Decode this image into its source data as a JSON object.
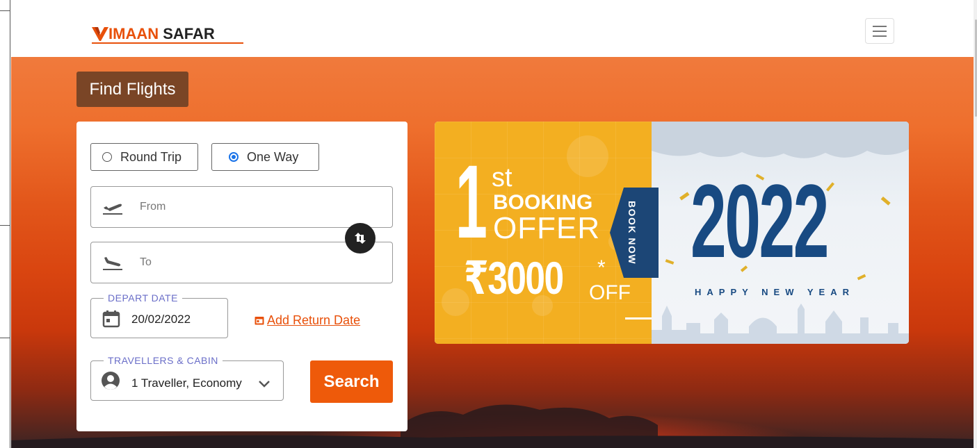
{
  "brand": {
    "name_part1": "IMAAN",
    "name_part2": " SAFAR",
    "accent_color": "#e8500a"
  },
  "header": {
    "menu_icon": "hamburger-icon"
  },
  "search_panel": {
    "title": "Find Flights",
    "trip_types": [
      {
        "label": "Round Trip",
        "selected": false
      },
      {
        "label": "One Way",
        "selected": true
      }
    ],
    "from": {
      "placeholder": "From",
      "value": "",
      "icon": "takeoff-plane-icon"
    },
    "to": {
      "placeholder": "To",
      "value": "",
      "icon": "landing-plane-icon"
    },
    "swap_icon": "swap-arrows-icon",
    "depart_date": {
      "label": "DEPART DATE",
      "value": "20/02/2022",
      "icon": "calendar-icon"
    },
    "add_return_label": "Add Return Date",
    "travellers": {
      "label": "TRAVELLERS & CABIN",
      "value": "1 Traveller, Economy",
      "icon": "user-icon"
    },
    "search_label": "Search",
    "search_color": "#ee5a0a"
  },
  "banner": {
    "first": "1",
    "st": "st",
    "booking": "BOOKING",
    "offer": "OFFER",
    "amount": "₹3000",
    "star": "*",
    "off": "OFF",
    "book_now": "BOOK NOW",
    "year": "2022",
    "greeting": "HAPPY NEW YEAR"
  }
}
